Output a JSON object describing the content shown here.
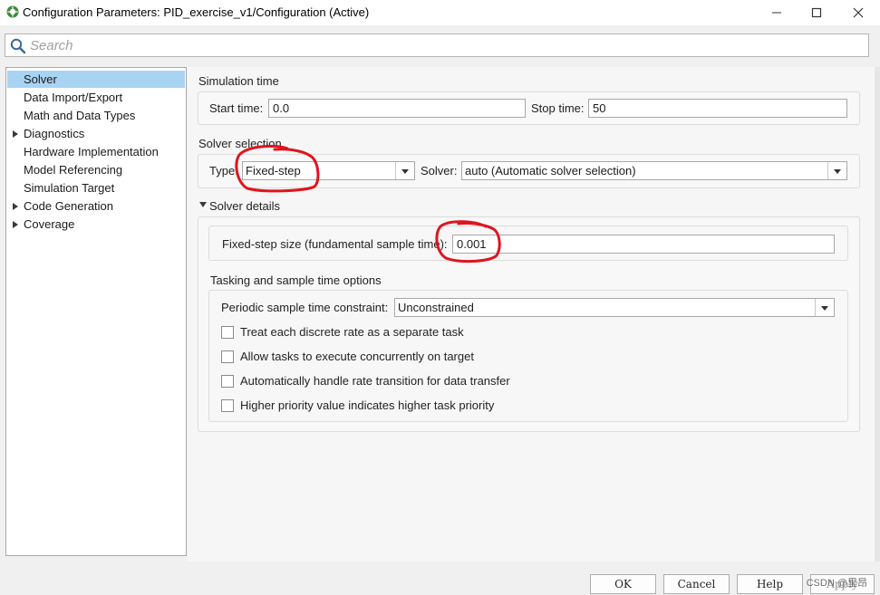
{
  "window": {
    "title": "Configuration Parameters: PID_exercise_v1/Configuration (Active)",
    "controls": [
      "minimize-icon",
      "maximize-icon",
      "close-icon"
    ]
  },
  "search": {
    "placeholder": "Search"
  },
  "tree": {
    "items": [
      {
        "label": "Solver",
        "expandable": false,
        "selected": true
      },
      {
        "label": "Data Import/Export",
        "expandable": false
      },
      {
        "label": "Math and Data Types",
        "expandable": false
      },
      {
        "label": "Diagnostics",
        "expandable": true
      },
      {
        "label": "Hardware Implementation",
        "expandable": false
      },
      {
        "label": "Model Referencing",
        "expandable": false
      },
      {
        "label": "Simulation Target",
        "expandable": false
      },
      {
        "label": "Code Generation",
        "expandable": true
      },
      {
        "label": "Coverage",
        "expandable": true
      }
    ]
  },
  "simulation_time": {
    "section": "Simulation time",
    "start_label": "Start time:",
    "start_value": "0.0",
    "stop_label": "Stop time:",
    "stop_value": "50"
  },
  "solver_selection": {
    "section": "Solver selection",
    "type_label": "Type:",
    "type_value": "Fixed-step",
    "solver_label": "Solver:",
    "solver_value": "auto (Automatic solver selection)"
  },
  "solver_details": {
    "section": "Solver details",
    "step_label": "Fixed-step size (fundamental sample time):",
    "step_value": "0.001"
  },
  "tasking": {
    "section": "Tasking and sample time options",
    "periodic_label": "Periodic sample time constraint:",
    "periodic_value": "Unconstrained",
    "checkboxes": [
      {
        "label": "Treat each discrete rate as a separate task",
        "checked": false
      },
      {
        "label": "Allow tasks to execute concurrently on target",
        "checked": false
      },
      {
        "label": "Automatically handle rate transition for data transfer",
        "checked": false
      },
      {
        "label": "Higher priority value indicates higher task priority",
        "checked": false
      }
    ]
  },
  "buttons": {
    "ok": "OK",
    "cancel": "Cancel",
    "help": "Help",
    "apply": "Apply"
  },
  "watermark": "CSDN @里昂",
  "colors": {
    "selection": "#a9d3f2",
    "annotation": "#e0141e"
  }
}
